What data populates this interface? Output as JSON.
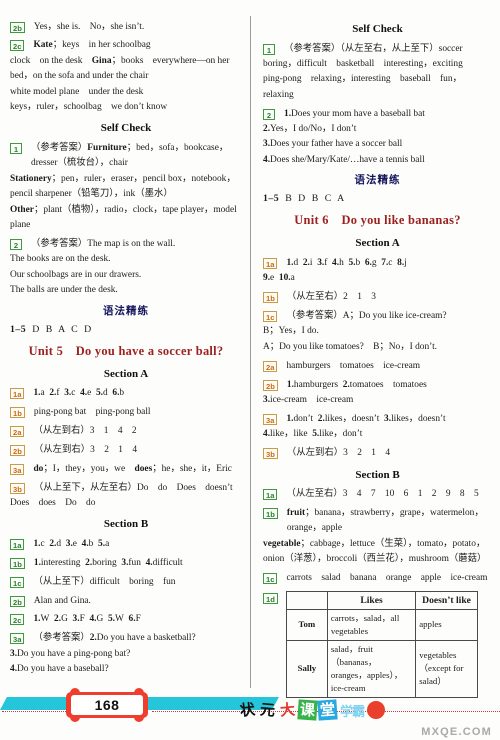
{
  "page": {
    "number": "168",
    "logo_chars": [
      "状",
      "元",
      "大",
      "课",
      "堂"
    ],
    "logo_sub": "学霸",
    "watermark": "MXQE.COM"
  },
  "left_column": {
    "blocks": [
      {
        "type": "item",
        "badge": "2b",
        "badge_color": "green",
        "text": "Yes，she is. No，she isn’t."
      },
      {
        "type": "item",
        "badge": "2c",
        "badge_color": "green",
        "text_html": "<span class='b'>Kate</span>；keys in her schoolbag"
      },
      {
        "type": "cont",
        "text_html": "clock on the desk <span class='b'>Gina</span>；books everywhere—on her bed，on the sofa and under the chair"
      },
      {
        "type": "cont",
        "text": "white model plane under the desk"
      },
      {
        "type": "cont",
        "text": "keys，ruler，schoolbag we don’t know"
      },
      {
        "type": "heading-center",
        "text": "Self Check"
      },
      {
        "type": "item",
        "badge": "1",
        "badge_color": "green",
        "text_html": "（参考答案）<span class='b'>Furniture</span>；bed，sofa，bookcase，dresser（梳妆台），chair"
      },
      {
        "type": "cont",
        "text_html": "<span class='b'>Stationery</span>；pen，ruler，eraser，pencil box，notebook，pencil sharpener（铅笔刀），ink（墨水）"
      },
      {
        "type": "cont",
        "text_html": "<span class='b'>Other</span>；plant（植物），radio，clock，tape player，model plane"
      },
      {
        "type": "item",
        "badge": "2",
        "badge_color": "green",
        "text": "（参考答案）The map is on the wall."
      },
      {
        "type": "cont",
        "text": "The books are on the desk."
      },
      {
        "type": "cont",
        "text": "Our schoolbags are in our drawers."
      },
      {
        "type": "cont",
        "text": "The balls are under the desk."
      },
      {
        "type": "heading-cn",
        "text": "语法精练"
      },
      {
        "type": "answer-line",
        "seq": "1–5",
        "vals": "D B A C D"
      },
      {
        "type": "heading-unit",
        "text": "Unit 5 Do you have a soccer ball?"
      },
      {
        "type": "heading-center",
        "text": "Section A"
      },
      {
        "type": "item",
        "badge": "1a",
        "badge_color": "orange",
        "text_html": "<span class='b'>1.</span>a <span class='b'>2.</span>f <span class='b'>3.</span>c <span class='b'>4.</span>e <span class='b'>5.</span>d <span class='b'>6.</span>b"
      },
      {
        "type": "item",
        "badge": "1b",
        "badge_color": "orange",
        "text": "ping-pong bat ping-pong ball"
      },
      {
        "type": "item",
        "badge": "2a",
        "badge_color": "orange",
        "text": "（从左到右）3 1 4 2"
      },
      {
        "type": "item",
        "badge": "2b",
        "badge_color": "orange",
        "text": "（从左到右）3 2 1 4"
      },
      {
        "type": "item",
        "badge": "3a",
        "badge_color": "orange",
        "text_html": "<span class='b'>do</span>；I，they，you，we <span class='b'>does</span>；he，she，it，Eric"
      },
      {
        "type": "item",
        "badge": "3b",
        "badge_color": "orange",
        "text": "（从上至下，从左至右）Do do Does doesn’t"
      },
      {
        "type": "cont",
        "text": "Does does Do do"
      },
      {
        "type": "heading-center",
        "text": "Section B"
      },
      {
        "type": "item",
        "badge": "1a",
        "badge_color": "green",
        "text_html": "<span class='b'>1.</span>c <span class='b'>2.</span>d <span class='b'>3.</span>e <span class='b'>4.</span>b <span class='b'>5.</span>a"
      },
      {
        "type": "item",
        "badge": "1b",
        "badge_color": "green",
        "text_html": "<span class='b'>1.</span>interesting <span class='b'>2.</span>boring <span class='b'>3.</span>fun <span class='b'>4.</span>difficult"
      },
      {
        "type": "item",
        "badge": "1c",
        "badge_color": "green",
        "text": "（从上至下）difficult boring fun"
      },
      {
        "type": "item",
        "badge": "2b",
        "badge_color": "green",
        "text": "Alan and Gina."
      },
      {
        "type": "item",
        "badge": "2c",
        "badge_color": "green",
        "text_html": "<span class='b'>1.</span>W <span class='b'>2.</span>G <span class='b'>3.</span>F <span class='b'>4.</span>G <span class='b'>5.</span>W <span class='b'>6.</span>F"
      },
      {
        "type": "item",
        "badge": "3a",
        "badge_color": "green",
        "text_html": "（参考答案）<span class='b'>2.</span>Do you have a basketball?"
      },
      {
        "type": "cont",
        "text_html": "<span class='b'>3.</span>Do you have a ping-pong bat?"
      },
      {
        "type": "cont",
        "text_html": "<span class='b'>4.</span>Do you have a baseball?"
      }
    ]
  },
  "right_column": {
    "blocks": [
      {
        "type": "heading-center",
        "text": "Self Check"
      },
      {
        "type": "item",
        "badge": "1",
        "badge_color": "green",
        "text": "（参考答案）（从左至右，从上至下）soccer"
      },
      {
        "type": "cont",
        "text": "boring，difficult basketball interesting，exciting"
      },
      {
        "type": "cont",
        "text": "ping-pong relaxing，interesting baseball fun，relaxing"
      },
      {
        "type": "item",
        "badge": "2",
        "badge_color": "green",
        "text_html": "<span class='b'>1.</span>Does your mom have a baseball bat"
      },
      {
        "type": "cont",
        "text_html": "<span class='b'>2.</span>Yes，I do/No，I don’t"
      },
      {
        "type": "cont",
        "text_html": "<span class='b'>3.</span>Does your father have a soccer ball"
      },
      {
        "type": "cont",
        "text_html": "<span class='b'>4.</span>Does she/Mary/Kate/…have a tennis ball"
      },
      {
        "type": "heading-cn",
        "text": "语法精练"
      },
      {
        "type": "answer-line",
        "seq": "1–5",
        "vals": "B D B C A"
      },
      {
        "type": "heading-unit",
        "text": "Unit 6 Do you like bananas?"
      },
      {
        "type": "heading-center",
        "text": "Section A"
      },
      {
        "type": "item",
        "badge": "1a",
        "badge_color": "orange",
        "text_html": "<span class='b'>1.</span>d <span class='b'>2.</span>i <span class='b'>3.</span>f <span class='b'>4.</span>h <span class='b'>5.</span>b <span class='b'>6.</span>g <span class='b'>7.</span>c <span class='b'>8.</span>j"
      },
      {
        "type": "cont",
        "text_html": "<span class='b'>9.</span>e <span class='b'>10.</span>a"
      },
      {
        "type": "item",
        "badge": "1b",
        "badge_color": "orange",
        "text": "（从左至右）2 1 3"
      },
      {
        "type": "item",
        "badge": "1c",
        "badge_color": "orange",
        "text": "（参考答案）A；Do you like ice-cream?"
      },
      {
        "type": "cont",
        "text": "B；Yes，I do."
      },
      {
        "type": "cont",
        "text": "A；Do you like tomatoes? B；No，I don’t."
      },
      {
        "type": "item",
        "badge": "2a",
        "badge_color": "orange",
        "text": "hamburgers tomatoes ice-cream"
      },
      {
        "type": "item",
        "badge": "2b",
        "badge_color": "orange",
        "text_html": "<span class='b'>1.</span>hamburgers <span class='b'>2.</span>tomatoes tomatoes"
      },
      {
        "type": "cont",
        "text_html": "<span class='b'>3.</span>ice-cream ice-cream"
      },
      {
        "type": "item",
        "badge": "3a",
        "badge_color": "orange",
        "text_html": "<span class='b'>1.</span>don’t <span class='b'>2.</span>likes，doesn’t <span class='b'>3.</span>likes，doesn’t"
      },
      {
        "type": "cont",
        "text_html": "<span class='b'>4.</span>like，like <span class='b'>5.</span>like，don’t"
      },
      {
        "type": "item",
        "badge": "3b",
        "badge_color": "orange",
        "text": "（从左到右）3 2 1 4"
      },
      {
        "type": "heading-center",
        "text": "Section B"
      },
      {
        "type": "item",
        "badge": "1a",
        "badge_color": "green",
        "text": "（从左至右）3 4 7 10 6 1 2 9 8 5"
      },
      {
        "type": "item",
        "badge": "1b",
        "badge_color": "green",
        "text_html": "<span class='b'>fruit</span>；banana，strawberry，grape，watermelon，orange，apple"
      },
      {
        "type": "cont",
        "text_html": "<span class='b'>vegetable</span>；cabbage，lettuce（生菜），tomato，potato，onion（洋葱），broccoli（西兰花），mushroom（蘑菇）"
      },
      {
        "type": "item",
        "badge": "1c",
        "badge_color": "green",
        "text": "carrots salad banana orange apple ice-cream"
      },
      {
        "type": "table",
        "badge": "1d",
        "badge_color": "green"
      }
    ],
    "table": {
      "headers": [
        "",
        "Likes",
        "Doesn’t like"
      ],
      "rows": [
        {
          "name": "Tom",
          "likes": "carrots，salad，all vegetables",
          "dislikes": "apples"
        },
        {
          "name": "Sally",
          "likes": "salad，fruit（bananas，oranges，apples），ice-cream",
          "dislikes": "vegetables（except for salad）"
        }
      ]
    }
  }
}
